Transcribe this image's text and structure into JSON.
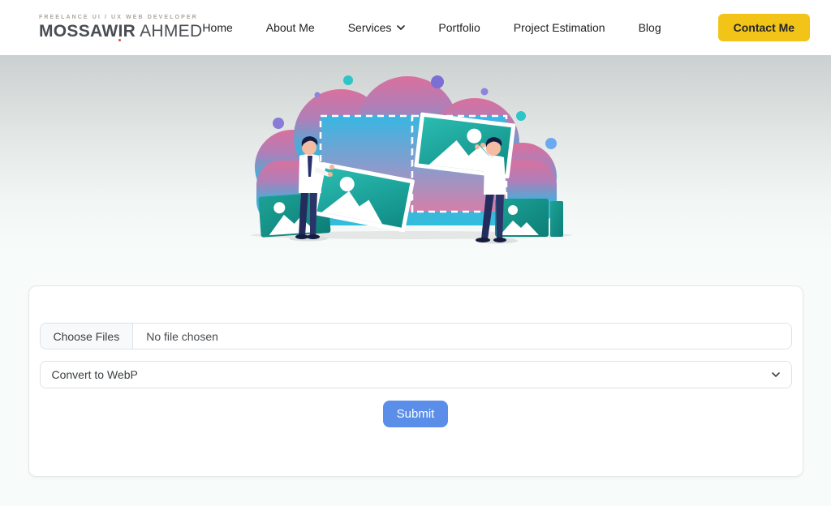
{
  "header": {
    "logo": {
      "tagline": "FREELANCE UI / UX WEB DEVELOPER",
      "name_bold": "MOSSAWIR",
      "name_light": "AHMED"
    },
    "nav": {
      "items": [
        {
          "label": "Home"
        },
        {
          "label": "About Me"
        },
        {
          "label": "Services"
        },
        {
          "label": "Portfolio"
        },
        {
          "label": "Project Estimation"
        },
        {
          "label": "Blog"
        }
      ],
      "contact_button_label": "Contact Me"
    }
  },
  "form": {
    "file_input": {
      "button_label": "Choose Files",
      "status_text": "No file chosen"
    },
    "format_select": {
      "selected_option": "Convert to WebP"
    },
    "submit_label": "Submit"
  },
  "colors": {
    "accent_yellow": "#F2C418",
    "accent_blue": "#5A8EE9",
    "header_bg": "#FFFFFF",
    "page_bg": "#F7FBFA",
    "logo_red_dot": "#DC4437"
  }
}
